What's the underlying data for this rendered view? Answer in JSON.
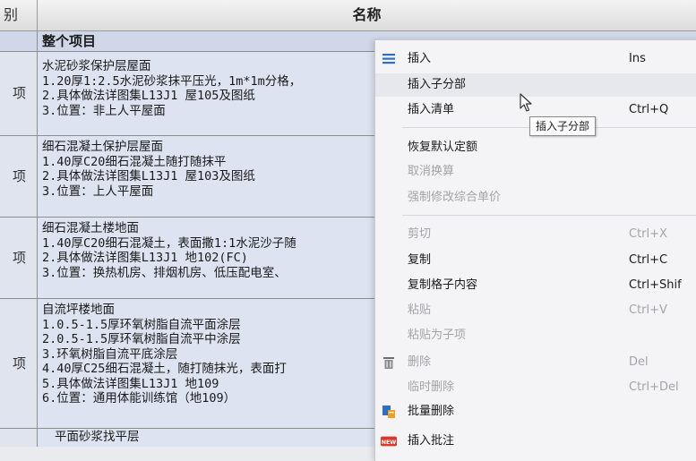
{
  "header": {
    "type_col": "别",
    "name_col": "名称"
  },
  "rows": [
    {
      "type": "",
      "lines": [
        "整个项目"
      ]
    },
    {
      "type": "项",
      "lines": [
        "水泥砂浆保护层屋面",
        "1.20厚1:2.5水泥砂浆抹平压光，1m*1m分格，",
        "2.具体做法详图集L13J1 屋105及图纸",
        "3.位置：非上人平屋面"
      ]
    },
    {
      "type": "项",
      "lines": [
        "细石混凝土保护层屋面",
        "1.40厚C20细石混凝土随打随抹平",
        "2.具体做法详图集L13J1 屋103及图纸",
        "3.位置：上人平屋面"
      ]
    },
    {
      "type": "项",
      "lines": [
        "细石混凝土楼地面",
        "1.40厚C20细石混凝土，表面撒1:1水泥沙子随",
        "2.具体做法详图集L13J1 地102(FC)",
        "3.位置：换热机房、排烟机房、低压配电室、"
      ]
    },
    {
      "type": "项",
      "lines": [
        "自流坪楼地面",
        "1.0.5-1.5厚环氧树脂自流平面涂层",
        "2.0.5-1.5厚环氧树脂自流平中涂层",
        "3.环氧树脂自流平底涂层",
        "4.40厚C25细石混凝土，随打随抹光，表面打",
        "5.具体做法详图集L13J1 地109",
        "6.位置：通用体能训练馆（地109）"
      ]
    },
    {
      "type": "",
      "lines": [
        "平面砂浆找平层"
      ]
    }
  ],
  "menu": {
    "items": [
      {
        "label": "插入",
        "shortcut": "Ins",
        "disabled": false,
        "icon": "insert-rows-icon"
      },
      {
        "label": "插入子分部",
        "shortcut": "",
        "disabled": false,
        "highlight": true
      },
      {
        "label": "插入清单",
        "shortcut": "Ctrl+Q",
        "disabled": false
      },
      {
        "label": "恢复默认定额",
        "shortcut": "",
        "disabled": false
      },
      {
        "label": "取消换算",
        "shortcut": "",
        "disabled": true
      },
      {
        "label": "强制修改综合单价",
        "shortcut": "",
        "disabled": true
      },
      {
        "label": "剪切",
        "shortcut": "Ctrl+X",
        "disabled": true
      },
      {
        "label": "复制",
        "shortcut": "Ctrl+C",
        "disabled": false
      },
      {
        "label": "复制格子内容",
        "shortcut": "Ctrl+Shif",
        "disabled": false
      },
      {
        "label": "粘贴",
        "shortcut": "Ctrl+V",
        "disabled": true
      },
      {
        "label": "粘贴为子项",
        "shortcut": "",
        "disabled": true
      },
      {
        "label": "删除",
        "shortcut": "Del",
        "disabled": true,
        "icon": "trash-icon"
      },
      {
        "label": "临时删除",
        "shortcut": "Ctrl+Del",
        "disabled": true
      },
      {
        "label": "批量删除",
        "shortcut": "",
        "disabled": false,
        "icon": "batch-delete-icon"
      },
      {
        "label": "插入批注",
        "shortcut": "",
        "disabled": false,
        "icon": "new-note-icon",
        "icon_text": "NEW"
      }
    ],
    "tooltip": "插入子分部"
  },
  "colors": {
    "row_bg": "#dde3f0",
    "menu_bg": "#f4f4f6",
    "disabled_text": "#a4a4a8",
    "icon_blue": "#2d6fc4",
    "icon_red": "#d8392b"
  }
}
